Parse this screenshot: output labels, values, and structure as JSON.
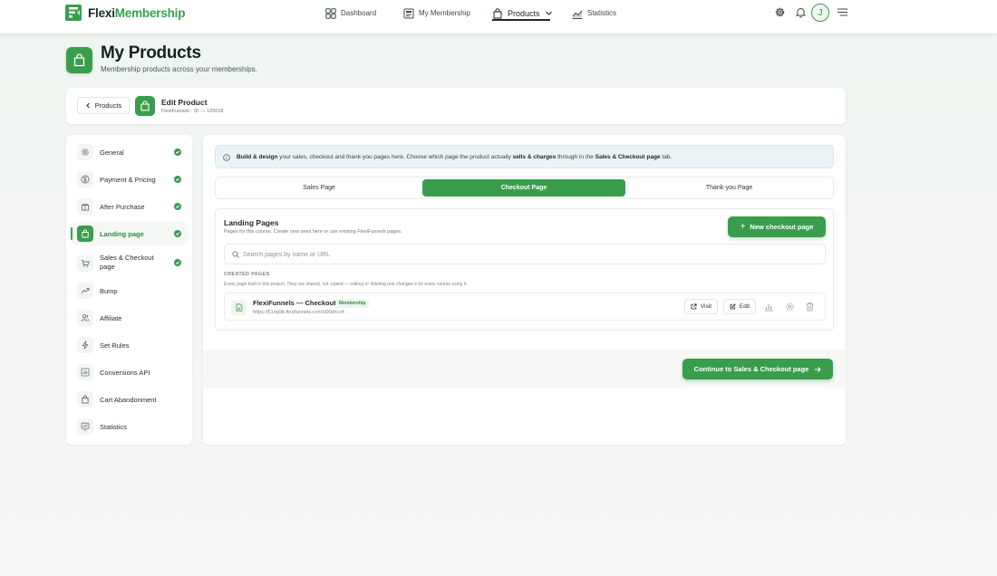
{
  "brand": {
    "part1": "Flexi",
    "part2": "Membership"
  },
  "nav": {
    "dashboard": "Dashboard",
    "membership": "My Membership",
    "products": "Products",
    "statistics": "Statistics"
  },
  "user": {
    "initial": "J"
  },
  "header": {
    "title": "My Products",
    "subtitle": "Membership products across your memberships."
  },
  "product": {
    "back_label": "Products",
    "title": "Edit Product",
    "meta": "FlexiFunnels · ID — 126618"
  },
  "menu": {
    "items": [
      {
        "label": "General",
        "icon": "gear-icon",
        "complete": true
      },
      {
        "label": "Payment & Pricing",
        "icon": "dollar-icon",
        "complete": true
      },
      {
        "label": "After Purchase",
        "icon": "gift-icon",
        "complete": true
      },
      {
        "label": "Landing page",
        "icon": "bag-icon",
        "complete": true,
        "active": true
      },
      {
        "label": "Sales & Checkout page",
        "icon": "cart-icon",
        "complete": true
      },
      {
        "label": "Bump",
        "icon": "trend-icon",
        "complete": false
      },
      {
        "label": "Affiliate",
        "icon": "users-icon",
        "complete": false
      },
      {
        "label": "Set Rules",
        "icon": "bolt-icon",
        "complete": false
      },
      {
        "label": "Conversions API",
        "icon": "bar-chart-icon",
        "complete": false
      },
      {
        "label": "Cart Abandonment",
        "icon": "bag-outline-icon",
        "complete": false
      },
      {
        "label": "Statistics",
        "icon": "stats-icon",
        "complete": false
      }
    ]
  },
  "info": {
    "t1": "Build & design",
    "t2": " your sales, checkout and thank-you pages here. Choose which page the product actually ",
    "t3": "sells & charges",
    "t4": " through in the ",
    "t5": "Sales & Checkout page",
    "t6": " tab."
  },
  "tabs": {
    "sales": "Sales Page",
    "checkout": "Checkout Page",
    "thankyou": "Thank-you Page",
    "active": "checkout"
  },
  "landing": {
    "title": "Landing Pages",
    "subtitle": "Pages for this course. Create new ones here or use existing FlexiFunnels pages.",
    "new_button": "New checkout page",
    "search_placeholder": "Search pages by name or URL",
    "created_label": "CREATED PAGES",
    "created_sub": "Every page built in this project. They are shared, not copied — editing or deleting one changes it for every course using it."
  },
  "page_row": {
    "name": "FlexiFunnels — Checkout",
    "badge": "Membership",
    "url": "https://61og9b.flexifunnels.com/u00shcz4",
    "visit": "Visit",
    "edit": "Edit"
  },
  "footer": {
    "continue": "Continue to Sales & Checkout page"
  },
  "colors": {
    "accent": "#3a9d4e",
    "info_bg": "#eaf3f6",
    "page_bg": "#f3f5f3"
  }
}
